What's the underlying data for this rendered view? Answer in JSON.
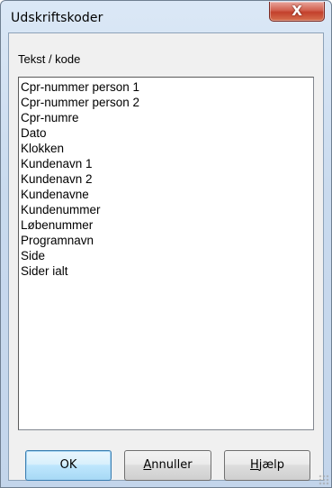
{
  "window": {
    "title": "Udskriftskoder",
    "close_glyph": "X"
  },
  "group": {
    "label": "Tekst / kode"
  },
  "list": {
    "items": [
      "Cpr-nummer person 1",
      "Cpr-nummer person 2",
      "Cpr-numre",
      "Dato",
      "Klokken",
      "Kundenavn 1",
      "Kundenavn 2",
      "Kundenavne",
      "Kundenummer",
      "Løbenummer",
      "Programnavn",
      "Side",
      "Sider ialt"
    ]
  },
  "buttons": {
    "ok_label": "OK",
    "cancel_first": "A",
    "cancel_rest": "nnuller",
    "help_first": "H",
    "help_rest": "jælp"
  },
  "colors": {
    "close_button": "#c3402c",
    "default_button_border": "#3c7fb1",
    "frame": "#c9daee"
  }
}
